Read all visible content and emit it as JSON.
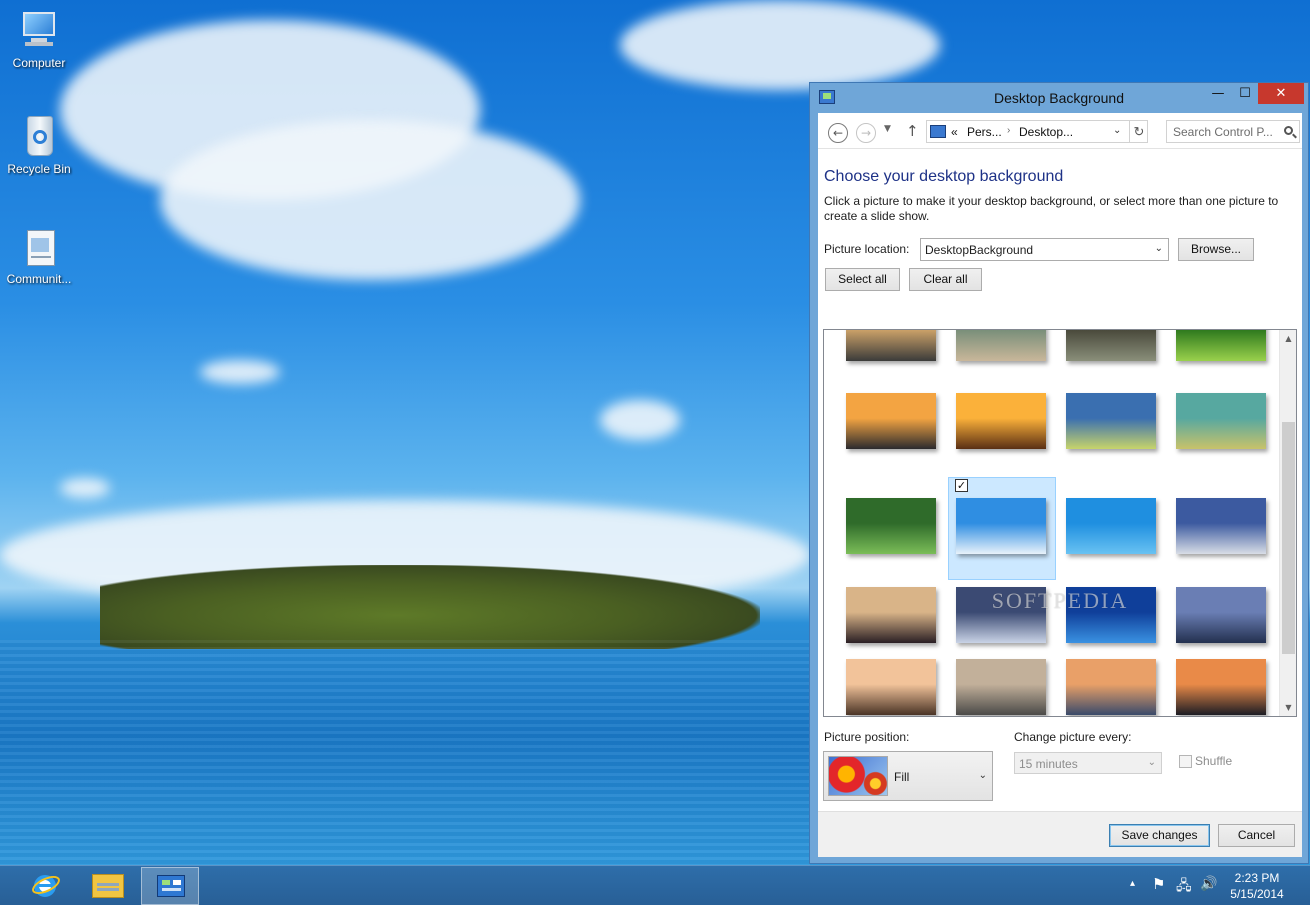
{
  "desktop": {
    "icons": [
      {
        "label": "Computer"
      },
      {
        "label": "Recycle Bin"
      },
      {
        "label": "Communit..."
      }
    ]
  },
  "window": {
    "title": "Desktop Background",
    "caption_buttons": {
      "minimize": "—",
      "maximize": "☐",
      "close": "✕"
    },
    "nav": {
      "back": "←",
      "forward": "→",
      "recent": "▼",
      "up": "↑",
      "address_prefix": "«",
      "crumbs": [
        "Pers...",
        "Desktop..."
      ],
      "separator": "›",
      "address_dropdown": "⌄",
      "refresh": "↻",
      "search_placeholder": "Search Control P..."
    },
    "heading": "Choose your desktop background",
    "description": "Click a picture to make it your desktop background, or select more than one picture to create a slide show.",
    "picture_location": {
      "label": "Picture location:",
      "value": "DesktopBackground",
      "arrow": "⌄",
      "browse_label": "Browse..."
    },
    "select_all_label": "Select all",
    "clear_all_label": "Clear all",
    "thumbnails": [
      {
        "name": "sunset-pier",
        "colors": [
          "#caa068",
          "#3b3b3a"
        ]
      },
      {
        "name": "boat-dock",
        "colors": [
          "#7a8f7a",
          "#c9b79a"
        ]
      },
      {
        "name": "rock-coast",
        "colors": [
          "#4a4a3c",
          "#8a8f7a"
        ]
      },
      {
        "name": "green-leaf-top",
        "colors": [
          "#2f7a1e",
          "#9ad14c"
        ]
      },
      {
        "name": "silhouette-sunset",
        "colors": [
          "#f3a442",
          "#2b2a2e"
        ]
      },
      {
        "name": "harbor-sunset",
        "colors": [
          "#fbb13a",
          "#5a2f14"
        ]
      },
      {
        "name": "cactus-plant",
        "colors": [
          "#3a6fb0",
          "#c7d46a"
        ]
      },
      {
        "name": "green-rock",
        "colors": [
          "#57a8a0",
          "#c8c26a"
        ]
      },
      {
        "name": "leaf-drops",
        "colors": [
          "#2f6b2a",
          "#7bbd58"
        ]
      },
      {
        "name": "island-sea",
        "colors": [
          "#2f8ee2",
          "#e8f2fa"
        ]
      },
      {
        "name": "blue-water",
        "colors": [
          "#1f8fe0",
          "#69c2f2"
        ]
      },
      {
        "name": "icicles",
        "colors": [
          "#3c5aa0",
          "#d8dde6"
        ]
      },
      {
        "name": "palm-sunset",
        "colors": [
          "#d9b488",
          "#2a1f24"
        ]
      },
      {
        "name": "pool-resort",
        "colors": [
          "#3b4a73",
          "#c9d3e6"
        ]
      },
      {
        "name": "deep-blue",
        "colors": [
          "#0f3f9a",
          "#3a92e2"
        ]
      },
      {
        "name": "mountain-dusk",
        "colors": [
          "#6a7eb4",
          "#23304f"
        ]
      },
      {
        "name": "lake-tree",
        "colors": [
          "#f2c39a",
          "#4a3426"
        ]
      },
      {
        "name": "rocky-shore",
        "colors": [
          "#c2b09a",
          "#4b4a48"
        ]
      },
      {
        "name": "sea-sunset",
        "colors": [
          "#e9a068",
          "#3a4a6a"
        ]
      },
      {
        "name": "palm-dusk",
        "colors": [
          "#e98a48",
          "#1c1c24"
        ]
      }
    ],
    "selected_check": "✓",
    "watermark": "SOFTPEDIA",
    "picture_position": {
      "label": "Picture position:",
      "value": "Fill",
      "arrow": "⌄"
    },
    "change_picture": {
      "label": "Change picture every:",
      "value": "15 minutes",
      "arrow": "⌄"
    },
    "shuffle_label": "Shuffle",
    "save_label": "Save changes",
    "cancel_label": "Cancel"
  },
  "taskbar": {
    "tray": {
      "chevron": "▴",
      "flag": "⚑",
      "network": "🖧",
      "volume": "🔊"
    },
    "time": "2:23 PM",
    "date": "5/15/2014"
  },
  "colors": {
    "accent": "#1e3287",
    "close_button": "#c7382d",
    "selection": "#cce8ff",
    "window_frame": "#6fa6d8",
    "taskbar": "#2a6399"
  }
}
